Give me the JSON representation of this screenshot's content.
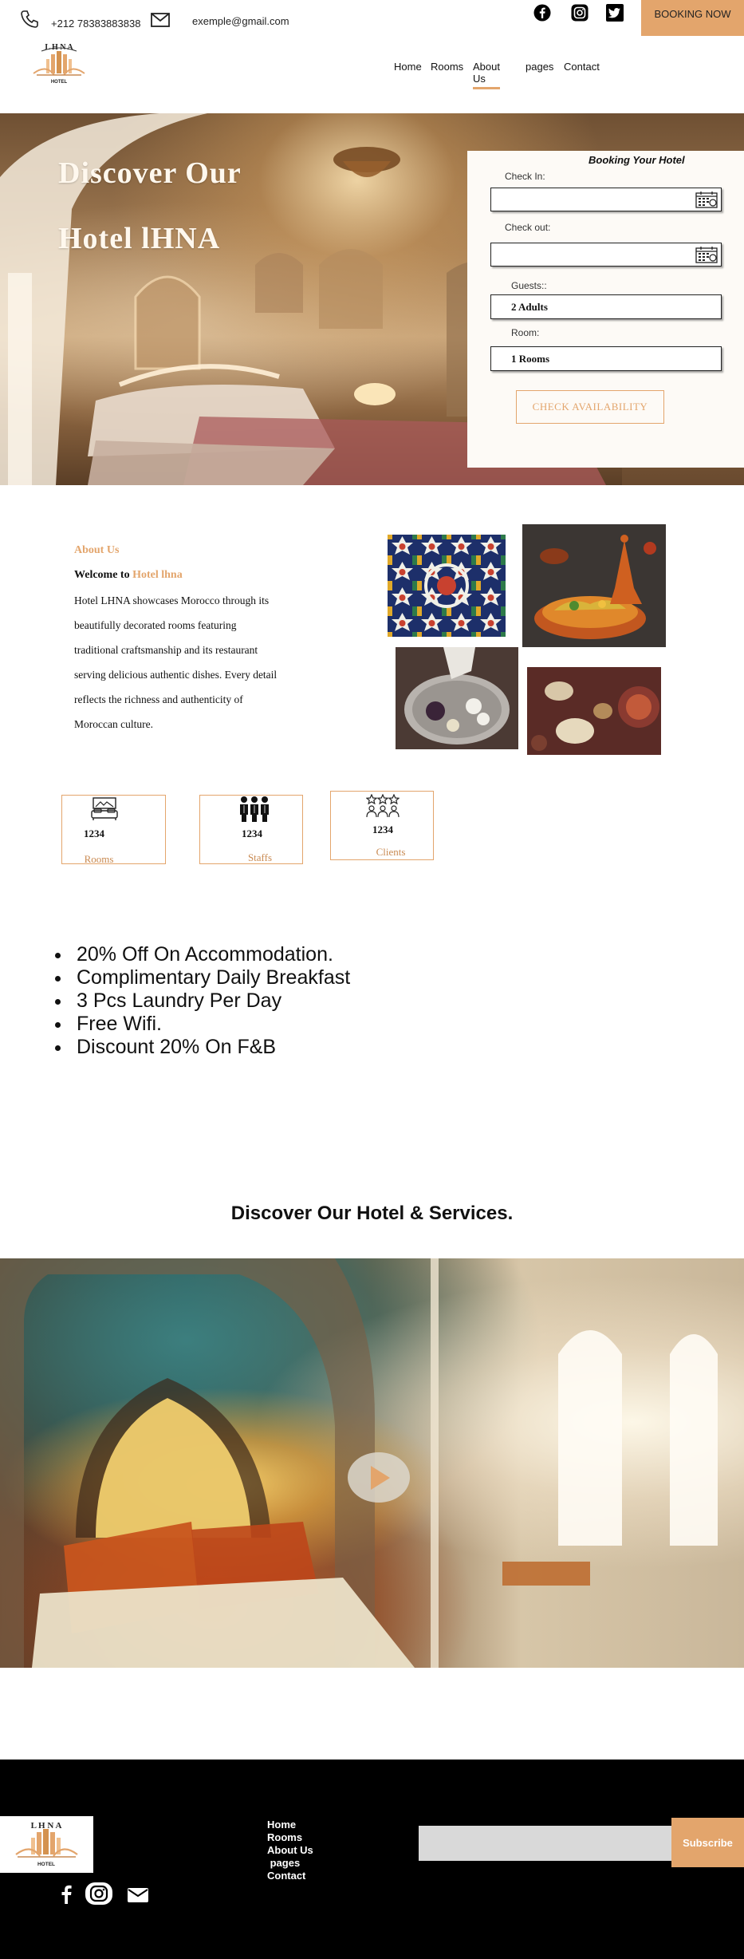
{
  "topbar": {
    "phone": "+212 78383883838",
    "email": "exemple@gmail.com",
    "booking_now": "BOOKING NOW"
  },
  "logo": {
    "title": "LHNA",
    "subtitle": "HOTEL"
  },
  "nav": {
    "items": [
      {
        "label": "Home"
      },
      {
        "label": "Rooms"
      },
      {
        "label": "About Us"
      },
      {
        "label": "pages"
      },
      {
        "label": "Contact"
      }
    ],
    "active": "About Us"
  },
  "hero": {
    "title_line1": "Discover Our",
    "title_line2": "Hotel lHNA"
  },
  "booking": {
    "title": "Booking Your Hotel",
    "check_in_label": "Check In:",
    "check_out_label": "Check out:",
    "guests_label": "Guests::",
    "guests_value": "2 Adults",
    "room_label": "Room:",
    "room_value": "1 Rooms",
    "button": "CHECK AVAILABILITY"
  },
  "about": {
    "label": "About Us",
    "welcome_prefix": "Welcome to",
    "welcome_highlight": "Hotel lhna",
    "lines": [
      "Hotel LHNA showcases Morocco through its",
      "beautifully decorated rooms featuring",
      "traditional craftsmanship and its restaurant",
      "serving delicious authentic dishes. Every detail",
      "reflects the richness and authenticity of",
      "Moroccan culture."
    ]
  },
  "stats": [
    {
      "number": "1234",
      "label": "Rooms",
      "icon": "bed-icon"
    },
    {
      "number": "1234",
      "label": "Staffs",
      "icon": "staff-icon"
    },
    {
      "number": "1234",
      "label": "Clients",
      "icon": "clients-icon"
    }
  ],
  "perks": [
    "20% Off On Accommodation.",
    "Complimentary Daily Breakfast",
    "3 Pcs Laundry Per Day",
    "Free Wifi.",
    "Discount 20% On F&B"
  ],
  "services": {
    "title": "Discover Our Hotel & Services."
  },
  "footer": {
    "links": [
      "Home",
      "Rooms",
      "About Us",
      " pages",
      "Contact"
    ],
    "subscribe": "Subscribe",
    "subscribe_placeholder": ""
  },
  "colors": {
    "accent": "#e3a56c",
    "footer_bg": "#000000"
  }
}
